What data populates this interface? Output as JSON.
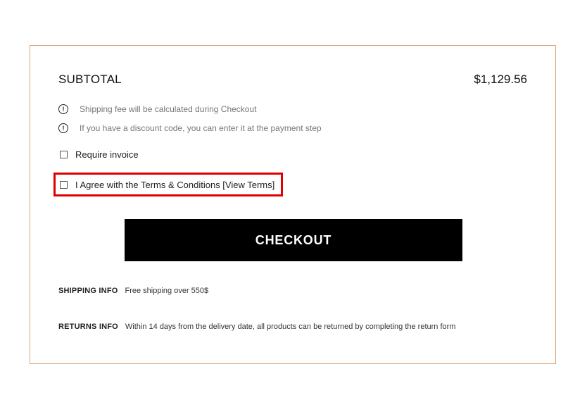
{
  "cart": {
    "subtotal_label": "SUBTOTAL",
    "subtotal_value": "$1,129.56",
    "notes": [
      {
        "icon": "info-icon",
        "text": "Shipping fee will be calculated during Checkout"
      },
      {
        "icon": "info-icon",
        "text": "If you have a discount code, you can enter it at the payment step"
      }
    ],
    "require_invoice_label": "Require invoice",
    "terms_label": "I Agree with the Terms & Conditions [View Terms]",
    "checkout_label": "CHECKOUT",
    "shipping_info_label": "SHIPPING INFO",
    "shipping_info_text": "Free shipping over 550$",
    "returns_info_label": "RETURNS INFO",
    "returns_info_text": "Within 14 days from the delivery date, all products can be returned by completing the return form"
  },
  "colors": {
    "panel_border": "#d9a273",
    "highlight": "#e00000",
    "button_bg": "#000000",
    "button_text": "#ffffff"
  }
}
